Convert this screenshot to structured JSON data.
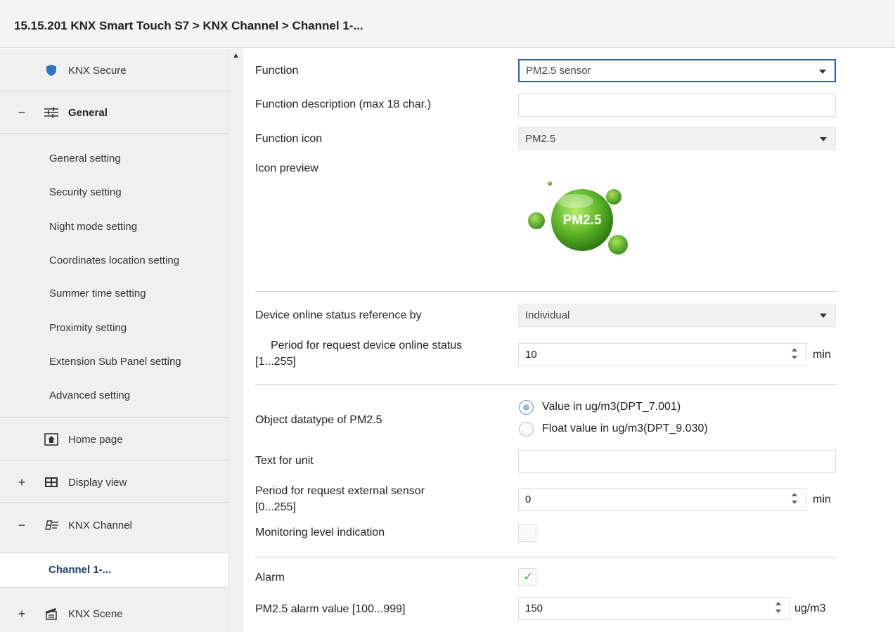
{
  "breadcrumb": "15.15.201 KNX Smart Touch S7 > KNX Channel  > Channel 1-...",
  "sidebar": {
    "knx_secure": "KNX Secure",
    "general": {
      "toggle": "−",
      "label": "General"
    },
    "general_items": [
      "General setting",
      "Security setting",
      "Night mode setting",
      "Coordinates location setting",
      "Summer time setting",
      "Proximity setting",
      "Extension Sub Panel setting",
      "Advanced setting"
    ],
    "home_page": "Home page",
    "display_view": {
      "toggle": "+",
      "label": "Display view"
    },
    "knx_channel": {
      "toggle": "−",
      "label": "KNX Channel"
    },
    "channel_selected": "Channel 1-...",
    "knx_scene": {
      "toggle": "+",
      "label": "KNX Scene"
    }
  },
  "params": {
    "function": {
      "label": "Function",
      "value": "PM2.5 sensor"
    },
    "function_description": {
      "label": "Function description (max 18 char.)",
      "value": ""
    },
    "function_icon": {
      "label": "Function icon",
      "value": "PM2.5"
    },
    "icon_preview": {
      "label": "Icon preview",
      "icon_text": "PM2.5",
      "icon_name": "pm25-bubble-icon"
    },
    "online_status_ref": {
      "label": "Device online status reference by",
      "value": "Individual"
    },
    "online_period": {
      "label_line1": "Period for request device online status",
      "label_line2": "[1...255]",
      "value": "10",
      "unit": "min"
    },
    "object_datatype": {
      "label": "Object datatype of PM2.5",
      "options": [
        "Value in ug/m3(DPT_7.001)",
        "Float value in ug/m3(DPT_9.030)"
      ],
      "selected": 0
    },
    "text_for_unit": {
      "label": "Text for unit",
      "value": ""
    },
    "external_period": {
      "label_line1": "Period for request external sensor",
      "label_line2": "[0...255]",
      "value": "0",
      "unit": "min"
    },
    "monitoring": {
      "label": "Monitoring level indication",
      "checked": false
    },
    "alarm": {
      "label": "Alarm",
      "checked": true,
      "tick": "✓"
    },
    "alarm_value": {
      "label": "PM2.5 alarm value [100...999]",
      "value": "150",
      "unit": "ug/m3"
    }
  },
  "colors": {
    "selected_text": "#1d3f73",
    "focus_border": "#2f5fa8",
    "icon_green": "#5fb82a",
    "shield_blue": "#2f73c6"
  }
}
